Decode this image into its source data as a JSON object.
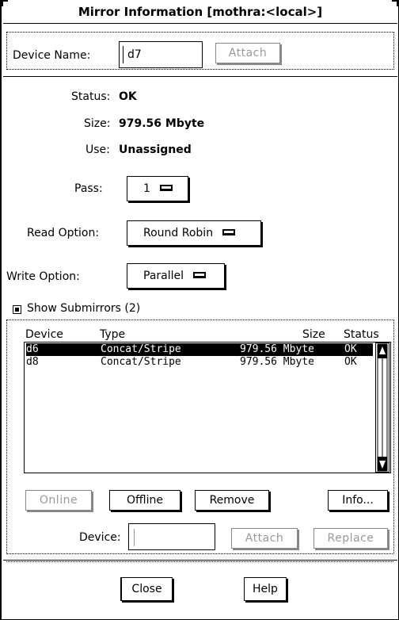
{
  "window": {
    "title": "Mirror Information [mothra:<local>]"
  },
  "device_section": {
    "label": "Device Name:",
    "value": "d7",
    "attach_label": "Attach"
  },
  "info": {
    "status_label": "Status:",
    "status_value": "OK",
    "size_label": "Size:",
    "size_value": "979.56 Mbyte",
    "use_label": "Use:",
    "use_value": "Unassigned",
    "pass_label": "Pass:",
    "pass_value": "1",
    "read_label": "Read Option:",
    "read_value": "Round Robin",
    "write_label": "Write Option:",
    "write_value": "Parallel"
  },
  "submirrors": {
    "toggle_label": "Show Submirrors (2)",
    "checked": true,
    "columns": {
      "device": "Device",
      "type": "Type",
      "size": "Size",
      "status": "Status"
    },
    "rows": [
      {
        "device": "d6",
        "type": "Concat/Stripe",
        "size": "979.56 Mbyte",
        "status": "OK",
        "selected": true
      },
      {
        "device": "d8",
        "type": "Concat/Stripe",
        "size": "979.56 Mbyte",
        "status": "OK",
        "selected": false
      }
    ],
    "buttons": {
      "online": "Online",
      "offline": "Offline",
      "remove": "Remove",
      "info": "Info..."
    },
    "device_label": "Device:",
    "device_value": "",
    "attach_label": "Attach",
    "replace_label": "Replace"
  },
  "footer": {
    "close_label": "Close",
    "help_label": "Help"
  }
}
